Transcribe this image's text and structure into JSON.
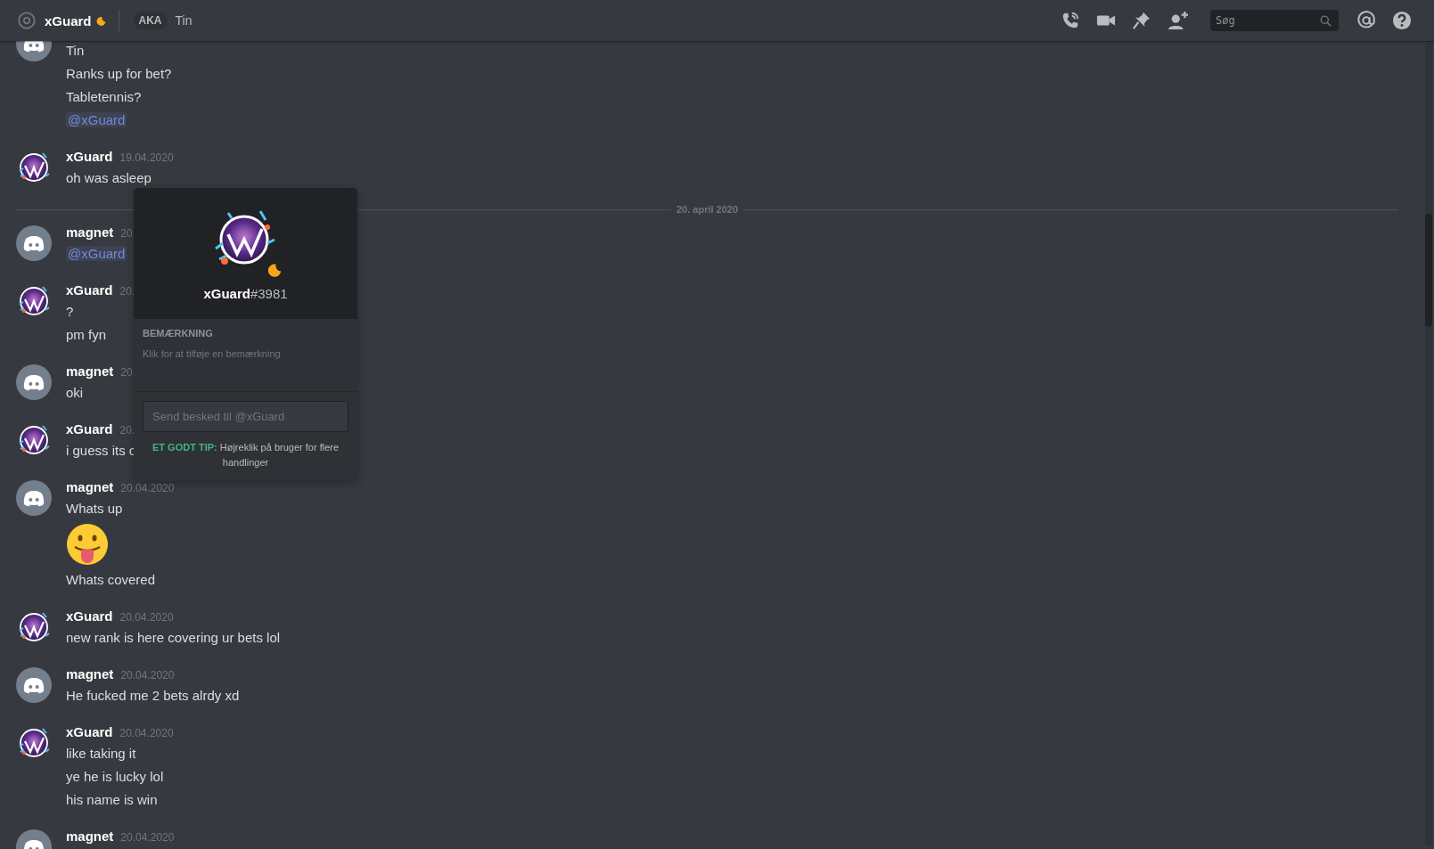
{
  "header": {
    "title": "xGuard",
    "idle": true,
    "aka_label": "AKA",
    "aka": "Tin",
    "search": {
      "placeholder": "Søg"
    }
  },
  "feed": [
    {
      "kind": "message",
      "avatar": {
        "kind": "default"
      },
      "lines": [
        {
          "kind": "text",
          "text": "Tin"
        },
        {
          "kind": "text",
          "text": "Ranks up for bet?"
        },
        {
          "kind": "text",
          "text": "Tabletennis?"
        },
        {
          "kind": "mention",
          "text": "@xGuard"
        }
      ]
    },
    {
      "kind": "message",
      "avatar": {
        "kind": "logo"
      },
      "author": "xGuard",
      "time": "19.04.2020",
      "lines": [
        {
          "kind": "text",
          "text": "oh was asleep"
        }
      ]
    },
    {
      "kind": "divider",
      "text": "20. april 2020"
    },
    {
      "kind": "message",
      "avatar": {
        "kind": "default"
      },
      "author": "magnet",
      "time": "20.",
      "lines": [
        {
          "kind": "mention",
          "text": "@xGuard"
        }
      ]
    },
    {
      "kind": "message",
      "avatar": {
        "kind": "logo"
      },
      "author": "xGuard",
      "time": "20.",
      "lines": [
        {
          "kind": "text",
          "text": "?"
        },
        {
          "kind": "text",
          "text": "pm fyn"
        }
      ]
    },
    {
      "kind": "message",
      "avatar": {
        "kind": "default"
      },
      "author": "magnet",
      "time": "20.",
      "lines": [
        {
          "kind": "text",
          "text": "oki"
        }
      ]
    },
    {
      "kind": "message",
      "avatar": {
        "kind": "logo"
      },
      "author": "xGuard",
      "time": "20.",
      "lines": [
        {
          "kind": "text",
          "text": "i guess its c"
        }
      ]
    },
    {
      "kind": "message",
      "avatar": {
        "kind": "default"
      },
      "author": "magnet",
      "time": "20.04.2020",
      "lines": [
        {
          "kind": "text",
          "text": "Whats up"
        },
        {
          "kind": "emoji"
        },
        {
          "kind": "text",
          "text": "Whats covered"
        }
      ]
    },
    {
      "kind": "message",
      "avatar": {
        "kind": "logo"
      },
      "author": "xGuard",
      "time": "20.04.2020",
      "lines": [
        {
          "kind": "text",
          "text": "new rank is here covering ur bets lol"
        }
      ]
    },
    {
      "kind": "message",
      "avatar": {
        "kind": "default"
      },
      "author": "magnet",
      "time": "20.04.2020",
      "lines": [
        {
          "kind": "text",
          "text": "He fucked me 2 bets alrdy xd"
        }
      ]
    },
    {
      "kind": "message",
      "avatar": {
        "kind": "logo"
      },
      "author": "xGuard",
      "time": "20.04.2020",
      "lines": [
        {
          "kind": "text",
          "text": "like taking it"
        },
        {
          "kind": "text",
          "text": "ye he is lucky lol"
        },
        {
          "kind": "text",
          "text": "his name is win"
        }
      ]
    },
    {
      "kind": "message",
      "avatar": {
        "kind": "default"
      },
      "author": "magnet",
      "time": "20.04.2020"
    }
  ],
  "popup": {
    "username": "xGuard",
    "tag": "#3981",
    "idle": true,
    "note_label": "BEMÆRKNING",
    "note_placeholder": "Klik for at tilføje en bemærkning",
    "message_placeholder": "Send besked til @xGuard",
    "tip_label": "ET GODT TIP:",
    "tip_text": "Højreklik på bruger for flere handlinger"
  }
}
